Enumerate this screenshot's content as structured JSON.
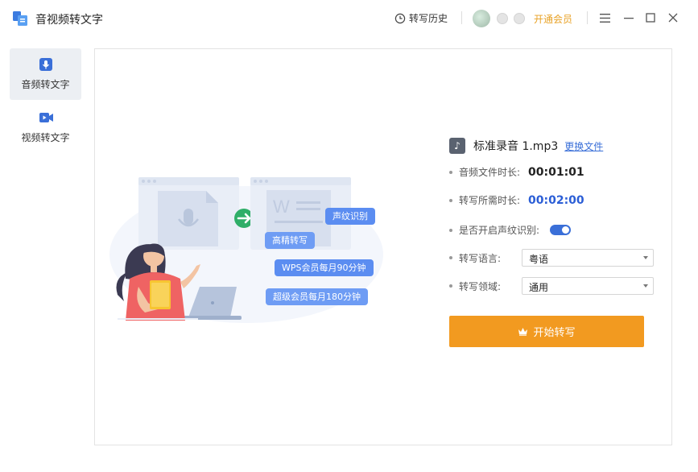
{
  "titlebar": {
    "app_title": "音视频转文字",
    "history_label": "转写历史",
    "vip_label": "开通会员"
  },
  "sidebar": {
    "items": [
      {
        "label": "音频转文字",
        "icon": "microphone-icon",
        "active": true
      },
      {
        "label": "视频转文字",
        "icon": "video-camera-icon",
        "active": false
      }
    ]
  },
  "illustration": {
    "bubbles": [
      "声纹识别",
      "高精转写",
      "WPS会员每月90分钟",
      "超级会员每月180分钟"
    ]
  },
  "file": {
    "name": "标准录音 1.mp3",
    "change_label": "更换文件"
  },
  "fields": {
    "duration_label": "音频文件时长:",
    "duration_value": "00:01:01",
    "needed_label": "转写所需时长:",
    "needed_value": "00:02:00",
    "voiceprint_label": "是否开启声纹识别:",
    "voiceprint_on": true,
    "language_label": "转写语言:",
    "language_value": "粤语",
    "domain_label": "转写领域:",
    "domain_value": "通用"
  },
  "start_button_label": "开始转写",
  "colors": {
    "accent_blue": "#3a6fd8",
    "start_orange": "#f29a20",
    "vip_gold": "#e8a226"
  }
}
